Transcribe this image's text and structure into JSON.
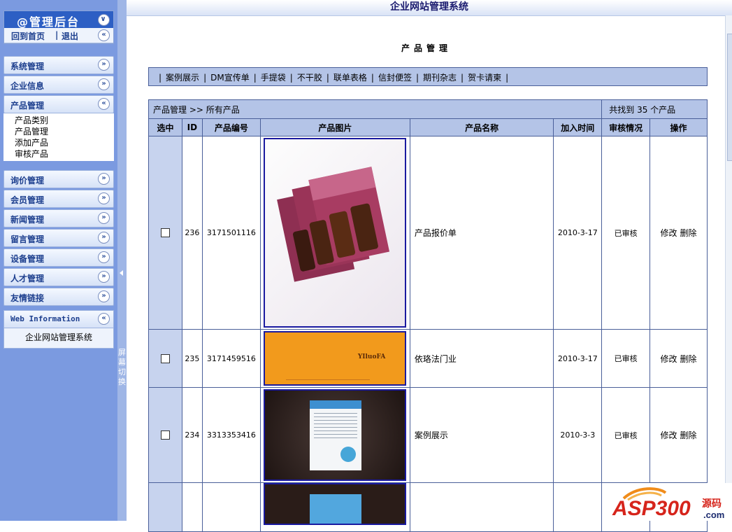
{
  "app": {
    "title": "企业网站管理系统"
  },
  "sidebar": {
    "header": "@管理后台",
    "links": {
      "home": "回到首页",
      "separator": "|",
      "logout": "退出"
    },
    "menus": [
      {
        "label": "系统管理",
        "expanded": false
      },
      {
        "label": "企业信息",
        "expanded": false
      },
      {
        "label": "产品管理",
        "expanded": true,
        "items": [
          "产品类别",
          "产品管理",
          "添加产品",
          "审核产品"
        ]
      },
      {
        "label": "询价管理",
        "expanded": false
      },
      {
        "label": "会员管理",
        "expanded": false
      },
      {
        "label": "新闻管理",
        "expanded": false
      },
      {
        "label": "留言管理",
        "expanded": false
      },
      {
        "label": "设备管理",
        "expanded": false
      },
      {
        "label": "人才管理",
        "expanded": false
      },
      {
        "label": "友情链接",
        "expanded": false
      }
    ],
    "info": {
      "title": "Web Information",
      "text": "企业网站管理系统"
    }
  },
  "splitter": {
    "label": "屏幕切换"
  },
  "main": {
    "page_title": "产品管理",
    "categories": [
      "案例展示",
      "DM宣传单",
      "手提袋",
      "不干胶",
      "联单表格",
      "信封便签",
      "期刊杂志",
      "贺卡请柬"
    ],
    "breadcrumb": "产品管理 >> 所有产品",
    "count_text": "共找到 35 个产品",
    "columns": [
      "选中",
      "ID",
      "产品编号",
      "产品图片",
      "产品名称",
      "加入时间",
      "审核情况",
      "操作"
    ],
    "rows": [
      {
        "id": "236",
        "code": "3171501116",
        "name": "产品报价单",
        "date": "2010-3-17",
        "status": "已审核",
        "edit": "修改",
        "delete": "删除",
        "image": "price-brochure"
      },
      {
        "id": "235",
        "code": "3171459516",
        "name": "依珞法门业",
        "date": "2010-3-17",
        "status": "已审核",
        "edit": "修改",
        "delete": "删除",
        "image": "orange-card",
        "image_text": "YIluoFA"
      },
      {
        "id": "234",
        "code": "3313353416",
        "name": "案例展示",
        "date": "2010-3-3",
        "status": "已审核",
        "edit": "修改",
        "delete": "删除",
        "image": "flyer-dark"
      },
      {
        "id": "",
        "code": "",
        "name": "",
        "date": "",
        "status": "",
        "edit": "",
        "delete": "",
        "image": "flyer-dark-blue"
      }
    ]
  },
  "watermark": {
    "brand": "ASP300",
    "suffix": "源码",
    "domain": ".com"
  }
}
